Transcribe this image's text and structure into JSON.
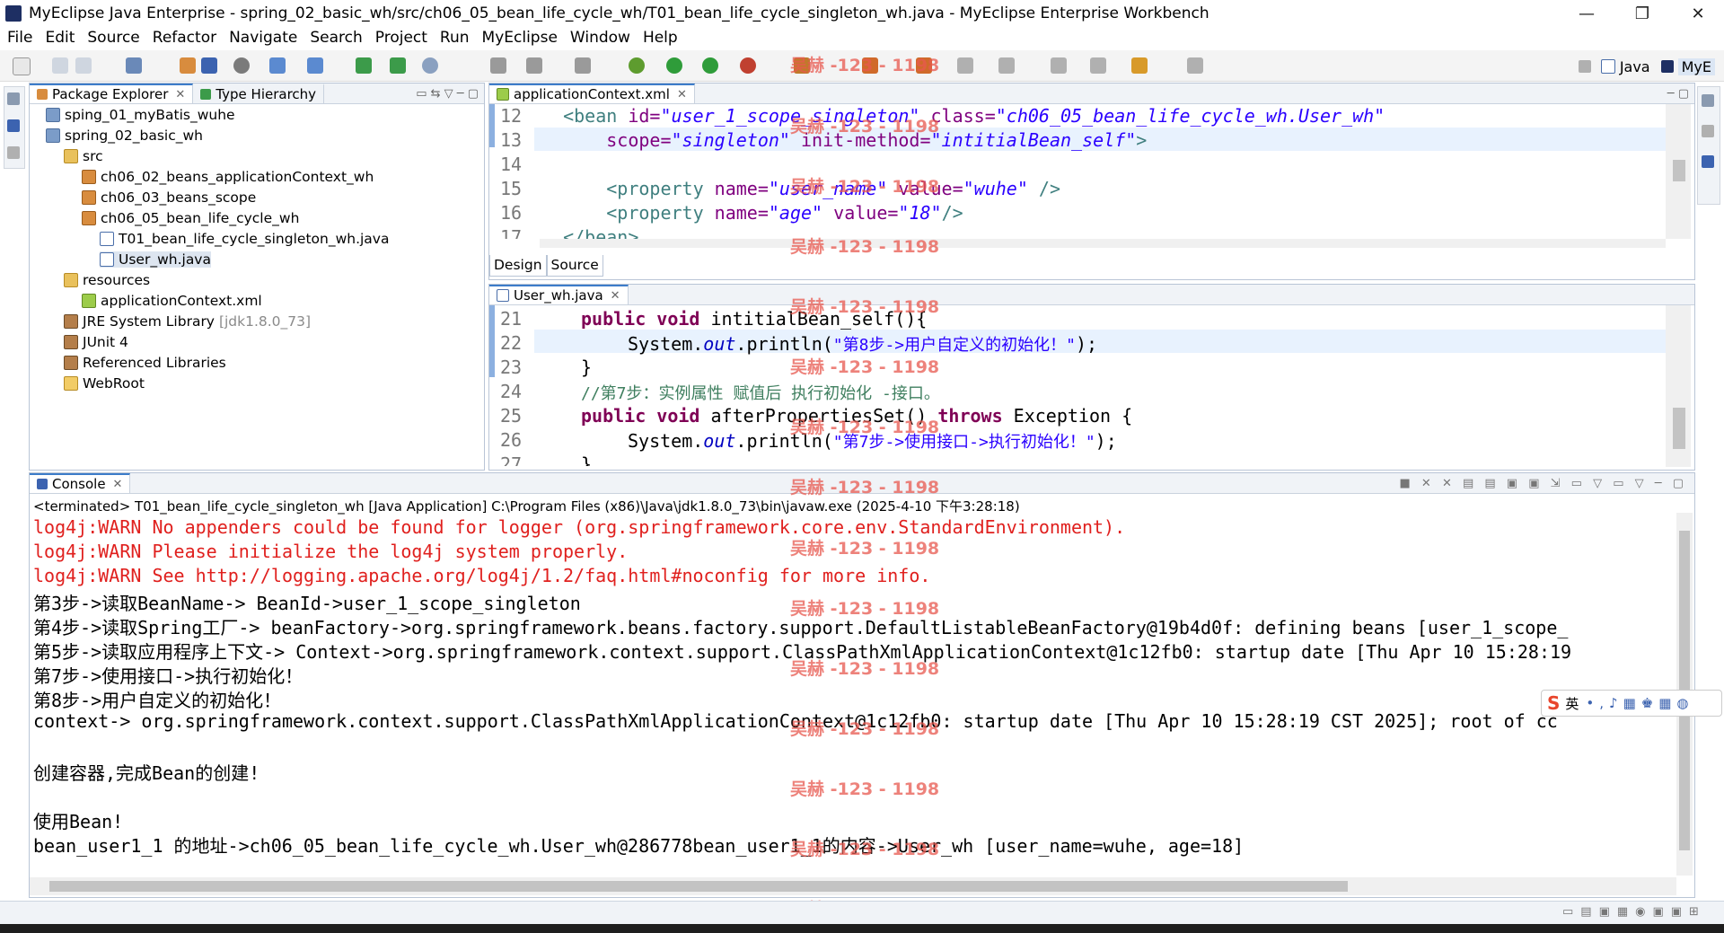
{
  "window": {
    "title": "MyEclipse Java Enterprise - spring_02_basic_wh/src/ch06_05_bean_life_cycle_wh/T01_bean_life_cycle_singleton_wh.java - MyEclipse Enterprise Workbench",
    "min": "—",
    "max": "❐",
    "close": "✕"
  },
  "menu": [
    "File",
    "Edit",
    "Source",
    "Refactor",
    "Navigate",
    "Search",
    "Project",
    "Run",
    "MyEclipse",
    "Window",
    "Help"
  ],
  "perspectives": [
    "Java",
    "MyE"
  ],
  "explorer": {
    "tabs": [
      "Package Explorer",
      "Type Hierarchy"
    ],
    "items": [
      {
        "label": "sping_01_myBatis_wuhe"
      },
      {
        "label": "spring_02_basic_wh"
      },
      {
        "label": "src"
      },
      {
        "label": "ch06_02_beans_applicationContext_wh"
      },
      {
        "label": "ch06_03_beans_scope"
      },
      {
        "label": "ch06_05_bean_life_cycle_wh"
      },
      {
        "label": "T01_bean_life_cycle_singleton_wh.java"
      },
      {
        "label": "User_wh.java"
      },
      {
        "label": "resources"
      },
      {
        "label": "applicationContext.xml"
      },
      {
        "label": "JRE System Library",
        "extra": "[jdk1.8.0_73]"
      },
      {
        "label": "JUnit 4"
      },
      {
        "label": "Referenced Libraries"
      },
      {
        "label": "WebRoot"
      }
    ]
  },
  "xml_editor": {
    "tab": "applicationContext.xml",
    "bottom_tabs": [
      "Design",
      "Source"
    ],
    "lines": [
      {
        "n": "12",
        "indent": "  ",
        "tag_open": "<bean ",
        "a1": "id=",
        "v1": "\"user_1_scope_singleton\"",
        "a2": " class=",
        "v2": "\"ch06_05_bean_life_cycle_wh.User_wh\""
      },
      {
        "n": "13",
        "indent": "      ",
        "a1": "scope=",
        "v1": "\"singleton\"",
        "a2": " init-method=",
        "v2": "\"intitialBean_self\"",
        "tag_close": ">"
      },
      {
        "n": "14"
      },
      {
        "n": "15",
        "indent": "      ",
        "tag_open": "<property ",
        "a1": "name=",
        "v1": "\"user_name\"",
        "a2": " value=",
        "v2": "\"wuhe\"",
        "tag_close": " />"
      },
      {
        "n": "16",
        "indent": "      ",
        "tag_open": "<property ",
        "a1": "name=",
        "v1": "\"age\"",
        "a2": " value=",
        "v2": "\"18\"",
        "tag_close": "/>"
      },
      {
        "n": "17",
        "indent": "  ",
        "tag_open": "</bean>"
      }
    ]
  },
  "java_editor": {
    "tab": "User_wh.java",
    "lines": [
      {
        "n": "21",
        "kw": "public void ",
        "rest": "intitialBean_self(){"
      },
      {
        "n": "22",
        "pre": "System.",
        "field": "out",
        "mid": ".println(",
        "str": "\"第8步->用户自定义的初始化！\"",
        "post": ");"
      },
      {
        "n": "23",
        "rest": "}"
      },
      {
        "n": "24",
        "comment": "//第7步：实例属性 赋值后 执行初始化 -接口。"
      },
      {
        "n": "25",
        "kw": "public void ",
        "rest": "afterPropertiesSet() ",
        "kw2": "throws ",
        "rest2": "Exception {"
      },
      {
        "n": "26",
        "pre": "System.",
        "field": "out",
        "mid": ".println(",
        "str": "\"第7步->使用接口->执行初始化！\"",
        "post": ");"
      },
      {
        "n": "27",
        "rest": "}"
      }
    ]
  },
  "console": {
    "tab": "Console",
    "header": "<terminated> T01_bean_life_cycle_singleton_wh [Java Application] C:\\Program Files (x86)\\Java\\jdk1.8.0_73\\bin\\javaw.exe (2025-4-10 下午3:28:18)",
    "lines": [
      {
        "text": "log4j:WARN No appenders could be found for logger (org.springframework.core.env.StandardEnvironment).",
        "err": true
      },
      {
        "text": "log4j:WARN Please initialize the log4j system properly.",
        "err": true
      },
      {
        "text": "log4j:WARN See http://logging.apache.org/log4j/1.2/faq.html#noconfig for more info.",
        "err": true
      },
      {
        "text": "第3步->读取BeanName-> BeanId->user_1_scope_singleton"
      },
      {
        "text": "第4步->读取Spring工厂-> beanFactory->org.springframework.beans.factory.support.DefaultListableBeanFactory@19b4d0f: defining beans [user_1_scope_"
      },
      {
        "text": "第5步->读取应用程序上下文-> Context->org.springframework.context.support.ClassPathXmlApplicationContext@1c12fb0: startup date [Thu Apr 10 15:28:19"
      },
      {
        "text": "第7步->使用接口->执行初始化！"
      },
      {
        "text": "第8步->用户自定义的初始化！"
      },
      {
        "text": "context-> org.springframework.context.support.ClassPathXmlApplicationContext@1c12fb0: startup date [Thu Apr 10 15:28:19 CST 2025]; root of cc"
      },
      {
        "text": ""
      },
      {
        "text": "创建容器,完成Bean的创建!"
      },
      {
        "text": ""
      },
      {
        "text": "使用Bean!"
      },
      {
        "text": "bean_user1_1 的地址->ch06_05_bean_life_cycle_wh.User_wh@286778bean_user1_1的内容->User_wh [user_name=wuhe, age=18]"
      }
    ]
  },
  "watermark": "吴赫 -123 - 1198",
  "ime": "英",
  "colors": {
    "accent": "#3d7cc9",
    "error": "#e0201e",
    "keyword": "#7f0055",
    "string": "#2a00ff"
  }
}
